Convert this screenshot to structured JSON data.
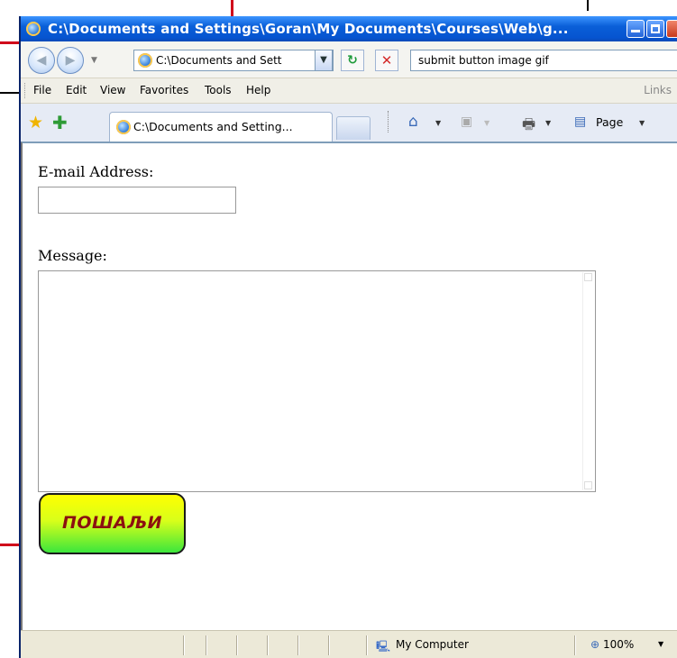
{
  "window": {
    "title": "C:\\Documents and Settings\\Goran\\My Documents\\Courses\\Web\\g..."
  },
  "navigation": {
    "address": "C:\\Documents and Sett",
    "search_query": "submit button  image gif"
  },
  "menu": {
    "items": [
      "File",
      "Edit",
      "View",
      "Favorites",
      "Tools",
      "Help"
    ],
    "links_label": "Links"
  },
  "tabs": {
    "active_tab_title": "C:\\Documents and Setting...",
    "page_menu_label": "Page"
  },
  "form": {
    "email_label": "E-mail Address:",
    "email_value": "",
    "message_label": "Message:",
    "message_value": "",
    "send_button_label": "ПОШАЉИ"
  },
  "status": {
    "zone": "My Computer",
    "zoom": "100%"
  },
  "colors": {
    "title_bar": "#0a5fd8",
    "annotation_red": "#d0001a",
    "send_button_top": "#ffff00",
    "send_button_bottom": "#3ce63c",
    "send_text": "#8b1010"
  }
}
